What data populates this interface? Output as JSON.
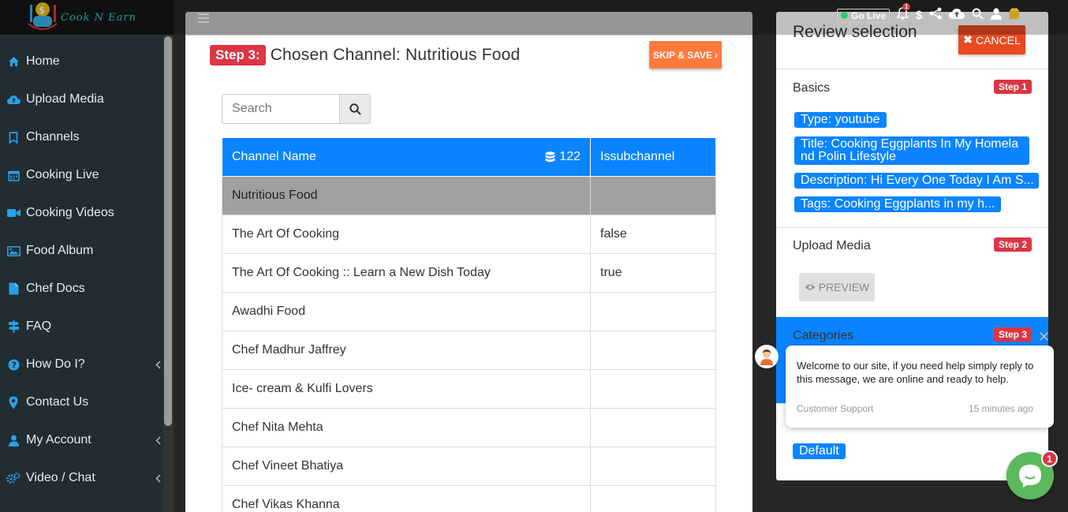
{
  "app": {
    "logo_text": "Cook N Earn"
  },
  "sidebar": {
    "items": [
      {
        "label": "Home",
        "icon": "home-icon"
      },
      {
        "label": "Upload Media",
        "icon": "cloud-upload-icon"
      },
      {
        "label": "Channels",
        "icon": "bookmark-icon"
      },
      {
        "label": "Cooking Live",
        "icon": "calendar-icon"
      },
      {
        "label": "Cooking Videos",
        "icon": "video-camera-icon"
      },
      {
        "label": "Food Album",
        "icon": "image-icon"
      },
      {
        "label": "Chef Docs",
        "icon": "file-icon"
      },
      {
        "label": "FAQ",
        "icon": "signpost-icon"
      },
      {
        "label": "How Do I?",
        "icon": "question-circle-icon",
        "has_caret": true
      },
      {
        "label": "Contact Us",
        "icon": "map-marker-icon"
      },
      {
        "label": "My Account",
        "icon": "user-icon",
        "has_caret": true
      },
      {
        "label": "Video / Chat",
        "icon": "cogs-icon",
        "has_caret": true
      }
    ]
  },
  "header": {
    "go_live": "Go Live",
    "notification_count": "1",
    "dollar": "$"
  },
  "main": {
    "step_badge": "Step 3:",
    "step_title": "Chosen Channel: Nutritious Food",
    "skip_button": "SKIP & SAVE",
    "search": {
      "placeholder": "Search"
    },
    "table": {
      "columns": [
        "Channel Name",
        "Issubchannel"
      ],
      "count": "122",
      "rows": [
        {
          "name": "Nutritious Food",
          "sub": "",
          "selected": true
        },
        {
          "name": "The Art Of Cooking",
          "sub": "false"
        },
        {
          "name": "The Art Of Cooking :: Learn a New Dish Today",
          "sub": "true"
        },
        {
          "name": "Awadhi Food",
          "sub": ""
        },
        {
          "name": "Chef Madhur Jaffrey",
          "sub": ""
        },
        {
          "name": "Ice- cream & Kulfi Lovers",
          "sub": ""
        },
        {
          "name": "Chef Nita Mehta",
          "sub": ""
        },
        {
          "name": "Chef Vineet Bhatiya",
          "sub": ""
        },
        {
          "name": "Chef Vikas Khanna",
          "sub": ""
        }
      ]
    }
  },
  "review": {
    "title": "Review selection",
    "cancel": "CANCEL",
    "basics": {
      "title": "Basics",
      "step": "Step 1",
      "tags": [
        "Type: youtube",
        "Title: Cooking Eggplants In My Homela nd Polin Lifestyle",
        "Description: Hi Every One Today I Am S...",
        "Tags: Cooking Eggplants in my h..."
      ]
    },
    "upload": {
      "title": "Upload Media",
      "step": "Step 2",
      "preview": "PREVIEW"
    },
    "categories": {
      "title": "Categories",
      "step": "Step 3"
    },
    "group": {
      "tag": "Default"
    }
  },
  "chat": {
    "message": "Welcome to our site, if you need help simply reply to this message, we are online and ready to help.",
    "from": "Customer Support",
    "time": "15 minutes ago",
    "badge": "1"
  },
  "colors": {
    "primary": "#0a84ff",
    "danger": "#dc3545",
    "sidebar": "#222d32",
    "accent": "#ff7a3d"
  }
}
